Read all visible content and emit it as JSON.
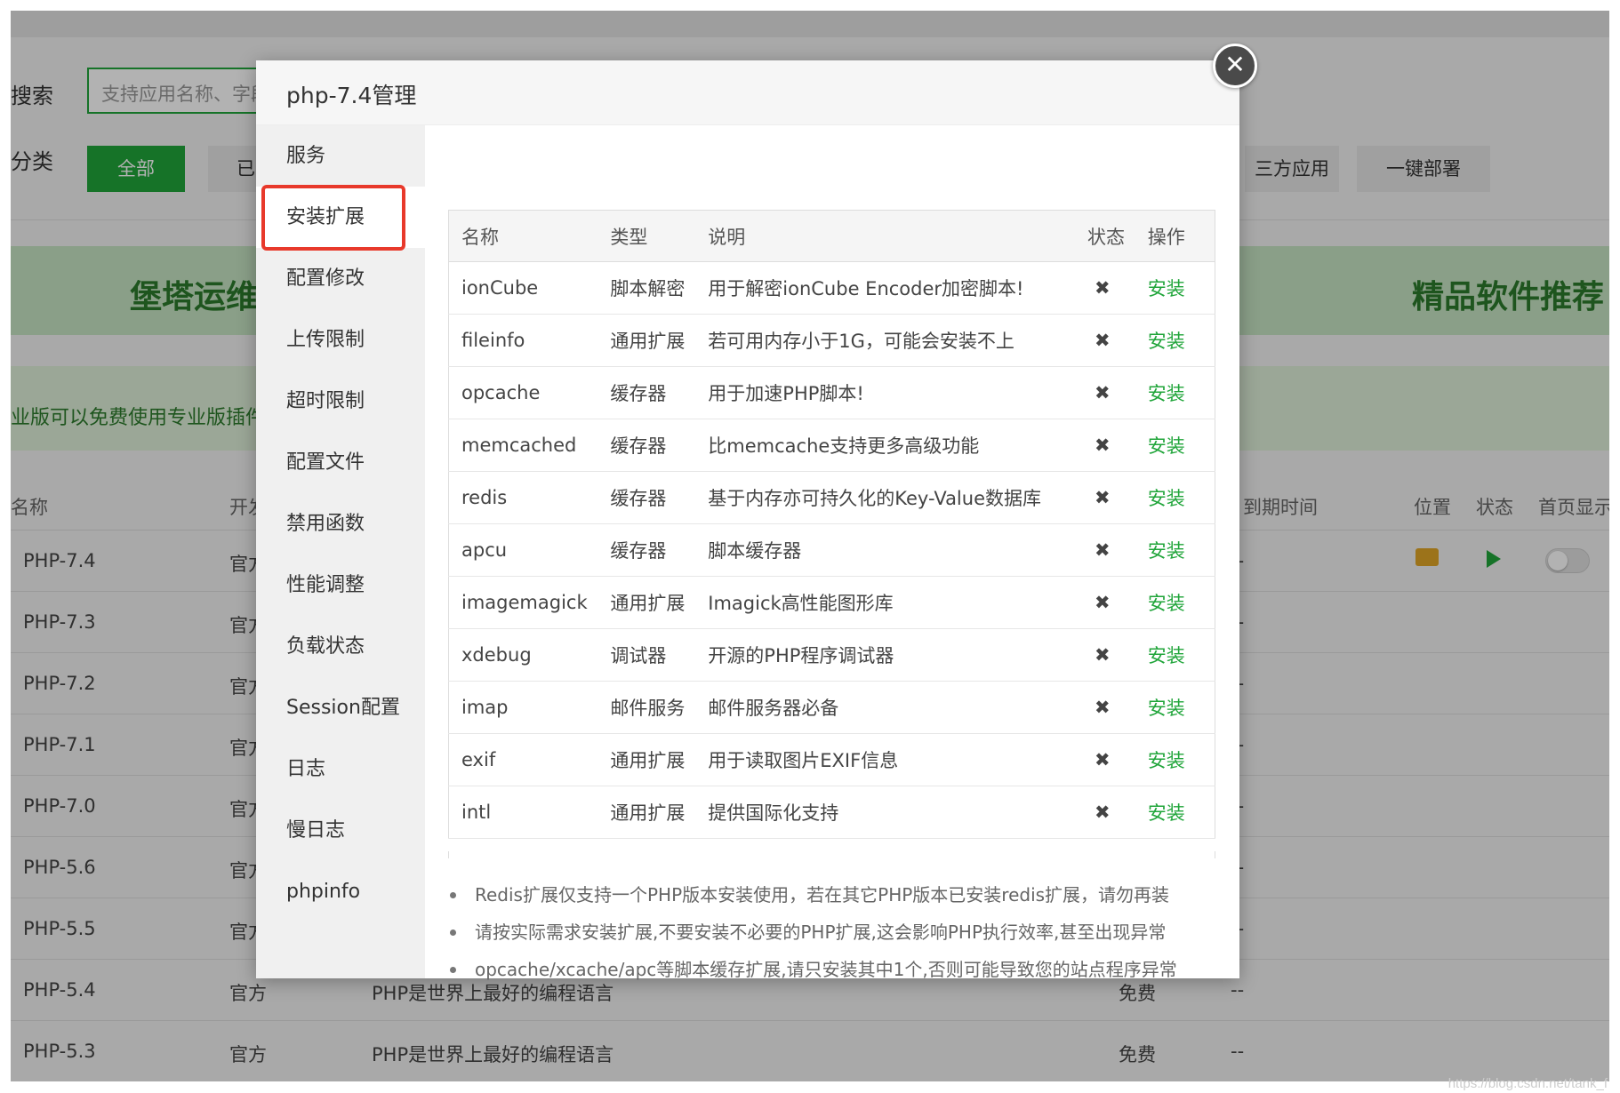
{
  "background": {
    "search_label": "搜索",
    "search_placeholder": "支持应用名称、字段",
    "category_label": "分类",
    "btn_all": "全部",
    "btn_partial": "已",
    "btn_third_party": "三方应用",
    "btn_deploy": "一键部署",
    "banner_left": "堡塔运维",
    "banner_right": "精品软件推荐",
    "notice": "业版可以免费使用专业版插件",
    "columns": [
      "名称",
      "开发",
      "到期时间",
      "位置",
      "状态",
      "首页显示"
    ],
    "rows": [
      {
        "name": "PHP-7.4",
        "dev": "官方",
        "desc": "",
        "price": "",
        "expire": "--"
      },
      {
        "name": "PHP-7.3",
        "dev": "官方",
        "desc": "",
        "price": "",
        "expire": "--"
      },
      {
        "name": "PHP-7.2",
        "dev": "官方",
        "desc": "",
        "price": "",
        "expire": "--"
      },
      {
        "name": "PHP-7.1",
        "dev": "官方",
        "desc": "",
        "price": "",
        "expire": "--"
      },
      {
        "name": "PHP-7.0",
        "dev": "官方",
        "desc": "",
        "price": "",
        "expire": "--"
      },
      {
        "name": "PHP-5.6",
        "dev": "官方",
        "desc": "",
        "price": "",
        "expire": "--"
      },
      {
        "name": "PHP-5.5",
        "dev": "官方",
        "desc": "",
        "price": "",
        "expire": "--"
      },
      {
        "name": "PHP-5.4",
        "dev": "官方",
        "desc": "PHP是世界上最好的编程语言",
        "price": "免费",
        "expire": "--"
      },
      {
        "name": "PHP-5.3",
        "dev": "官方",
        "desc": "PHP是世界上最好的编程语言",
        "price": "免费",
        "expire": "--"
      }
    ],
    "watermark": "https://blog.csdn.net/tank_f"
  },
  "modal": {
    "title": "php-7.4管理",
    "close_symbol": "✕",
    "nav": [
      "服务",
      "安装扩展",
      "配置修改",
      "上传限制",
      "超时限制",
      "配置文件",
      "禁用函数",
      "性能调整",
      "负载状态",
      "Session配置",
      "日志",
      "慢日志",
      "phpinfo"
    ],
    "active_nav": "安装扩展",
    "table": {
      "headers": [
        "名称",
        "类型",
        "说明",
        "状态",
        "操作"
      ],
      "rows": [
        {
          "name": "ionCube",
          "type": "脚本解密",
          "desc": "用于解密ionCube Encoder加密脚本!",
          "status": "✖",
          "op": "安装"
        },
        {
          "name": "fileinfo",
          "type": "通用扩展",
          "desc": "若可用内存小于1G，可能会安装不上",
          "status": "✖",
          "op": "安装"
        },
        {
          "name": "opcache",
          "type": "缓存器",
          "desc": "用于加速PHP脚本!",
          "status": "✖",
          "op": "安装"
        },
        {
          "name": "memcached",
          "type": "缓存器",
          "desc": "比memcache支持更多高级功能",
          "status": "✖",
          "op": "安装"
        },
        {
          "name": "redis",
          "type": "缓存器",
          "desc": "基于内存亦可持久化的Key-Value数据库",
          "status": "✖",
          "op": "安装"
        },
        {
          "name": "apcu",
          "type": "缓存器",
          "desc": "脚本缓存器",
          "status": "✖",
          "op": "安装"
        },
        {
          "name": "imagemagick",
          "type": "通用扩展",
          "desc": "Imagick高性能图形库",
          "status": "✖",
          "op": "安装"
        },
        {
          "name": "xdebug",
          "type": "调试器",
          "desc": "开源的PHP程序调试器",
          "status": "✖",
          "op": "安装"
        },
        {
          "name": "imap",
          "type": "邮件服务",
          "desc": "邮件服务器必备",
          "status": "✖",
          "op": "安装"
        },
        {
          "name": "exif",
          "type": "通用扩展",
          "desc": "用于读取图片EXIF信息",
          "status": "✖",
          "op": "安装"
        },
        {
          "name": "intl",
          "type": "通用扩展",
          "desc": "提供国际化支持",
          "status": "✖",
          "op": "安装"
        }
      ]
    },
    "tips": [
      "Redis扩展仅支持一个PHP版本安装使用，若在其它PHP版本已安装redis扩展，请勿再装",
      "请按实际需求安装扩展,不要安装不必要的PHP扩展,这会影响PHP执行效率,甚至出现异常",
      "opcache/xcache/apc等脚本缓存扩展,请只安装其中1个,否则可能导致您的站点程序异常"
    ]
  },
  "colors": {
    "accent": "#20a53a",
    "highlight": "#e8392b"
  }
}
